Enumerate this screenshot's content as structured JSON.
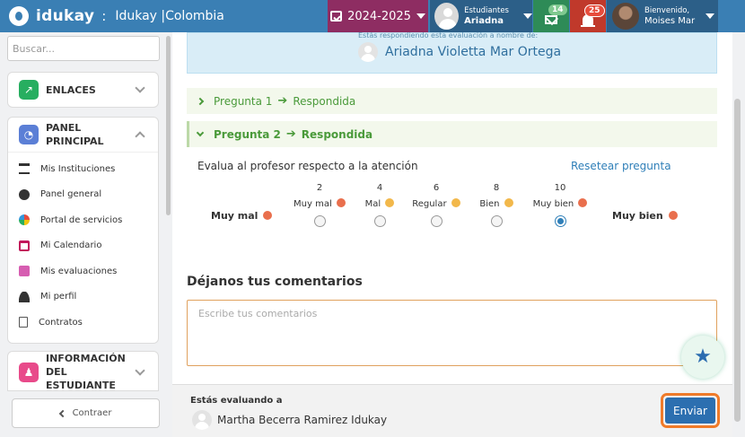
{
  "topbar": {
    "brand": "idukay",
    "separator": ":",
    "tenant": "Idukay |Colombia",
    "year": "2024-2025",
    "student": {
      "label": "Estudiantes",
      "name": "Ariadna"
    },
    "messages_count": "14",
    "notifications_count": "25",
    "user": {
      "greeting": "Bienvenido,",
      "name": "Moises Mar"
    }
  },
  "sidebar": {
    "search_placeholder": "Buscar...",
    "enlaces": {
      "title": "ENLACES",
      "color": "#27ae60"
    },
    "panel": {
      "title": "PANEL PRINCIPAL",
      "color": "#5b7fd6",
      "items": [
        {
          "label": "Mis Instituciones",
          "icon": "institution-icon"
        },
        {
          "label": "Panel general",
          "icon": "dashboard-icon"
        },
        {
          "label": "Portal de servicios",
          "icon": "services-icon"
        },
        {
          "label": "Mi Calendario",
          "icon": "calendar-icon"
        },
        {
          "label": "Mis evaluaciones",
          "icon": "evaluations-icon"
        },
        {
          "label": "Mi perfil",
          "icon": "user-icon"
        },
        {
          "label": "Contratos",
          "icon": "document-icon"
        }
      ]
    },
    "student_info": {
      "title": "INFORMACIÓN DEL ESTUDIANTE",
      "color": "#e84a8a"
    },
    "back_label": "Contraer"
  },
  "main": {
    "info_note": "Estás respondiendo esta evaluación a nombre de:",
    "info_name": "Ariadna Violetta Mar Ortega",
    "q1": {
      "label": "Pregunta 1",
      "status": "Respondida"
    },
    "q2": {
      "label": "Pregunta 2",
      "status": "Respondida"
    },
    "question_text": "Evalua al profesor respecto a la atención",
    "reset_label": "Resetear pregunta",
    "scale_min": "Muy mal",
    "scale_max": "Muy bien",
    "options": [
      {
        "value": "2",
        "label": "Muy mal",
        "selected": false
      },
      {
        "value": "4",
        "label": "Mal",
        "selected": false
      },
      {
        "value": "6",
        "label": "Regular",
        "selected": false
      },
      {
        "value": "8",
        "label": "Bien",
        "selected": false
      },
      {
        "value": "10",
        "label": "Muy bien",
        "selected": true
      }
    ],
    "comments_title": "Déjanos tus comentarios",
    "comments_placeholder": "Escribe tus comentarios"
  },
  "footer": {
    "evaluating_label": "Estás evaluando a",
    "evaluated_name": "Martha Becerra Ramirez Idukay",
    "send_label": "Enviar"
  }
}
